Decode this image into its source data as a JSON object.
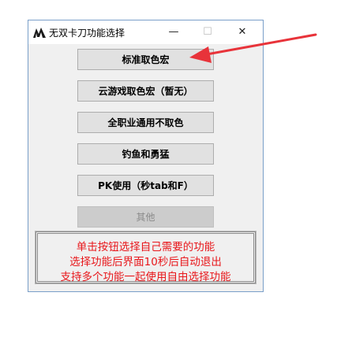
{
  "window": {
    "title": "无双卡刀功能选择",
    "min_symbol": "—",
    "max_symbol": "☐",
    "close_symbol": "✕"
  },
  "buttons": [
    {
      "label": "标准取色宏",
      "enabled": true
    },
    {
      "label": "云游戏取色宏（暂无）",
      "enabled": true
    },
    {
      "label": "全职业通用不取色",
      "enabled": true
    },
    {
      "label": "钓鱼和勇猛",
      "enabled": true
    },
    {
      "label": "PK使用（秒tab和F）",
      "enabled": true
    },
    {
      "label": "其他",
      "enabled": false
    }
  ],
  "notice": {
    "lines": [
      "单击按钮选择自己需要的功能",
      "选择功能后界面10秒后自动退出",
      "支持多个功能一起使用自由选择功能"
    ],
    "color": "#e8171b"
  },
  "annotation": {
    "arrow_color": "#e8333a"
  }
}
